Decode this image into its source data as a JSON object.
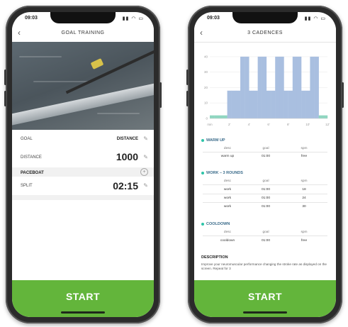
{
  "left": {
    "status": {
      "time": "09:03",
      "icons": "▮▮ ◠ ▭"
    },
    "nav": {
      "back": "‹",
      "title": "GOAL TRAINING"
    },
    "rows": {
      "goal_label": "GOAL",
      "goal_value": "DISTANCE",
      "distance_label": "DISTANCE",
      "distance_value": "1000",
      "paceboat_label": "PACEBOAT",
      "split_label": "SPLIT",
      "split_value": "02:15"
    },
    "start_label": "START"
  },
  "right": {
    "status": {
      "time": "09:03",
      "icons": "▮▮ ◠ ▭"
    },
    "nav": {
      "back": "‹",
      "title": "3 CADENCES"
    },
    "chart_data": {
      "type": "bar",
      "title": "",
      "ylabel": "",
      "y_ticks": [
        "40",
        "30",
        "20",
        "10",
        "0"
      ],
      "x_ticks": [
        "min",
        "2'",
        "4'",
        "6'",
        "8'",
        "10'",
        "12'"
      ],
      "ylim": [
        0,
        45
      ],
      "grid": true,
      "bar_color": "#a9bfe0",
      "baseline_color": "#8fd6c0",
      "values": [
        2,
        2,
        2,
        2,
        18,
        18,
        18,
        40,
        40,
        18,
        18,
        40,
        40,
        18,
        18,
        40,
        40,
        18,
        18,
        40,
        40,
        18,
        18,
        40,
        40,
        2,
        2
      ]
    },
    "sections": {
      "warmup": {
        "title": "WARM UP",
        "headers": [
          "desc",
          "goal",
          "spm"
        ],
        "rows": [
          [
            "warm up",
            "01:00",
            "free"
          ]
        ]
      },
      "work": {
        "title": "WORK – 3 ROUNDS",
        "headers": [
          "desc",
          "goal",
          "spm"
        ],
        "rows": [
          [
            "work",
            "01:00",
            "18"
          ],
          [
            "work",
            "01:00",
            "24"
          ],
          [
            "work",
            "01:00",
            "30"
          ]
        ]
      },
      "cooldown": {
        "title": "COOLDOWN",
        "headers": [
          "desc",
          "goal",
          "spm"
        ],
        "rows": [
          [
            "cooldown",
            "01:00",
            "free"
          ]
        ]
      }
    },
    "description": {
      "title": "DESCRIPTION",
      "text": "Improve your neuromuscular performance changing the stroke rate as displayed on the screen. Repeat for 3"
    },
    "start_label": "START"
  }
}
